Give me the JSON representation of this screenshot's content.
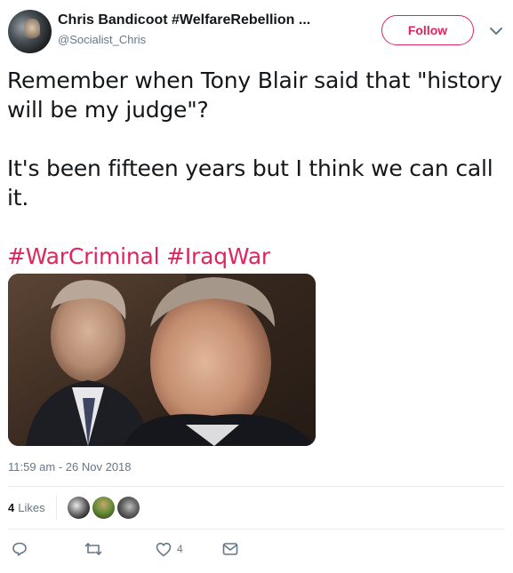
{
  "tweet": {
    "author": {
      "display_name": "Chris Bandicoot #WelfareRebellion ...",
      "handle": "@Socialist_Chris"
    },
    "follow_label": "Follow",
    "text": {
      "line1": "Remember when Tony Blair said that \"history will be my judge\"?",
      "line2": "It's been fifteen years but I think we can call it.",
      "hashtags": [
        "#WarCriminal",
        "#IraqWar"
      ]
    },
    "timestamp": "11:59 am - 26 Nov 2018",
    "likes": {
      "count": "4",
      "label": "Likes"
    },
    "actions": {
      "like_count": "4"
    }
  },
  "colors": {
    "accent": "#e0245e",
    "text": "#14171a",
    "muted": "#657786",
    "divider": "#e6ecf0"
  },
  "icons": {
    "more": "chevron-down-icon",
    "reply": "reply-icon",
    "retweet": "retweet-icon",
    "like": "heart-icon",
    "dm": "envelope-icon"
  }
}
